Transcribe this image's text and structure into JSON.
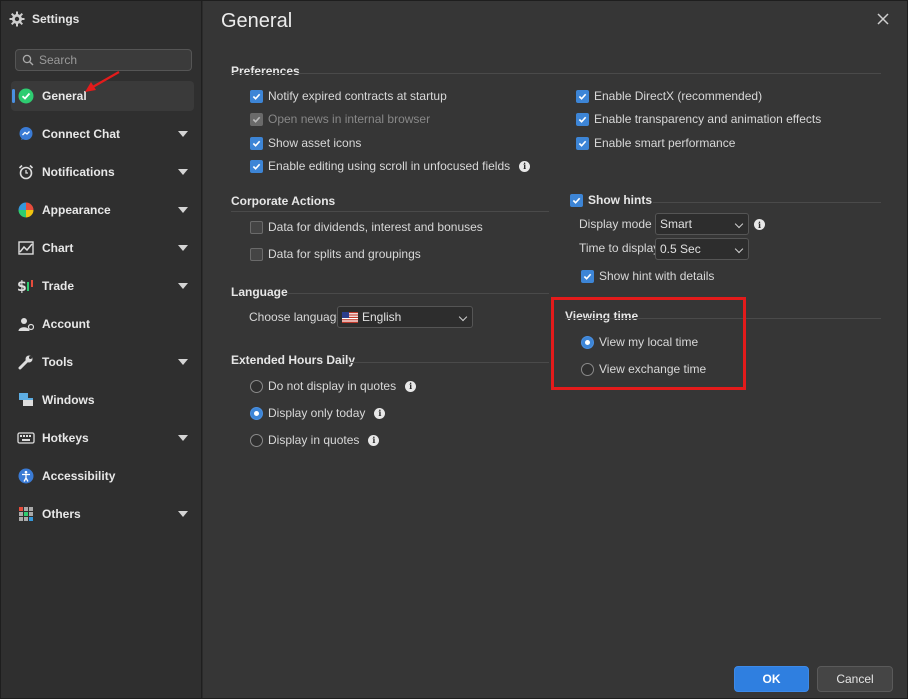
{
  "window": {
    "title": "Settings"
  },
  "search": {
    "placeholder": "Search"
  },
  "sidebar": {
    "items": [
      {
        "label": "General",
        "icon": "check-circle-icon",
        "active": true
      },
      {
        "label": "Connect Chat",
        "icon": "chat-icon",
        "expandable": true
      },
      {
        "label": "Notifications",
        "icon": "alarm-clock-icon",
        "expandable": true
      },
      {
        "label": "Appearance",
        "icon": "palette-icon",
        "expandable": true
      },
      {
        "label": "Chart",
        "icon": "chart-icon",
        "expandable": true
      },
      {
        "label": "Trade",
        "icon": "dollar-chart-icon",
        "expandable": true
      },
      {
        "label": "Account",
        "icon": "account-icon"
      },
      {
        "label": "Tools",
        "icon": "wrench-icon",
        "expandable": true
      },
      {
        "label": "Windows",
        "icon": "windows-icon"
      },
      {
        "label": "Hotkeys",
        "icon": "keyboard-icon",
        "expandable": true
      },
      {
        "label": "Accessibility",
        "icon": "accessibility-icon"
      },
      {
        "label": "Others",
        "icon": "grid-icon",
        "expandable": true
      }
    ]
  },
  "main": {
    "title": "General",
    "preferences": {
      "heading": "Preferences",
      "left": [
        {
          "label": "Notify expired contracts at startup",
          "state": "checked"
        },
        {
          "label": "Open news in internal browser",
          "state": "disabled-checked"
        },
        {
          "label": "Show asset icons",
          "state": "checked"
        },
        {
          "label": "Enable editing using scroll in unfocused fields",
          "state": "checked",
          "info": true
        }
      ],
      "right": [
        {
          "label": "Enable DirectX (recommended)",
          "state": "checked"
        },
        {
          "label": "Enable transparency and animation effects",
          "state": "checked"
        },
        {
          "label": "Enable smart performance",
          "state": "checked"
        }
      ]
    },
    "corporate_actions": {
      "heading": "Corporate Actions",
      "items": [
        {
          "label": "Data for dividends, interest and bonuses",
          "state": "unchecked"
        },
        {
          "label": "Data for splits and groupings",
          "state": "unchecked"
        }
      ]
    },
    "language": {
      "heading": "Language",
      "label": "Choose language",
      "value": "English"
    },
    "extended_hours": {
      "heading": "Extended Hours Daily",
      "options": [
        {
          "label": "Do not display in quotes",
          "selected": false
        },
        {
          "label": "Display only today",
          "selected": true
        },
        {
          "label": "Display in quotes",
          "selected": false
        }
      ]
    },
    "hints": {
      "heading": "Show hints",
      "display_mode_label": "Display mode",
      "display_mode_value": "Smart",
      "time_label": "Time to display",
      "time_value": "0.5 Sec",
      "details_label": "Show hint with details"
    },
    "viewing_time": {
      "heading": "Viewing time",
      "options": [
        {
          "label": "View my local time",
          "selected": true
        },
        {
          "label": "View exchange time",
          "selected": false
        }
      ]
    }
  },
  "footer": {
    "ok": "OK",
    "cancel": "Cancel"
  },
  "colors": {
    "accent": "#3d85d6",
    "highlight": "#e31b1b",
    "ok_button": "#2f7fe0"
  }
}
